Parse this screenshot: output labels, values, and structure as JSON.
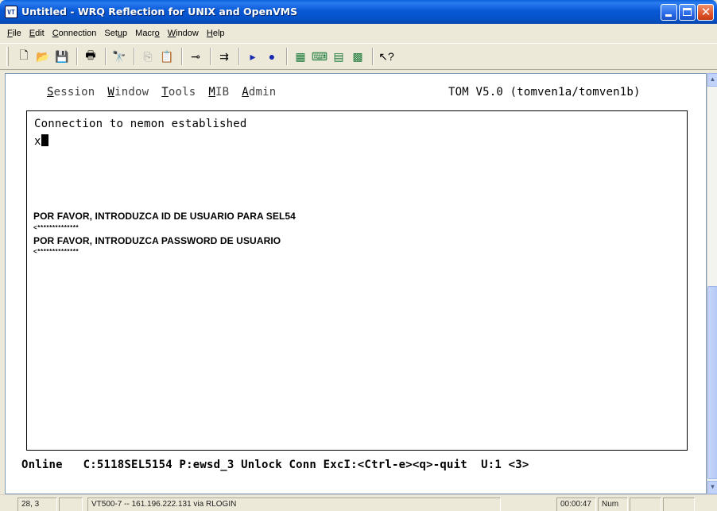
{
  "window": {
    "title": "Untitled - WRQ Reflection for UNIX and OpenVMS",
    "app_icon_label": "VT"
  },
  "menu": {
    "items": [
      {
        "label": "File",
        "accel": "F"
      },
      {
        "label": "Edit",
        "accel": "E"
      },
      {
        "label": "Connection",
        "accel": "C"
      },
      {
        "label": "Setup",
        "accel": "u"
      },
      {
        "label": "Macro",
        "accel": "o"
      },
      {
        "label": "Window",
        "accel": "W"
      },
      {
        "label": "Help",
        "accel": "H"
      }
    ]
  },
  "toolbar": {
    "buttons": [
      {
        "icon": "new-icon",
        "glyph": "🗋",
        "state": "enabled"
      },
      {
        "icon": "open-icon",
        "glyph": "📂",
        "state": "enabled"
      },
      {
        "icon": "save-icon",
        "glyph": "💾",
        "state": "enabled"
      },
      {
        "icon": "print-icon",
        "glyph": "🖶",
        "state": "enabled"
      },
      {
        "icon": "find-icon",
        "glyph": "🔭",
        "state": "enabled"
      },
      {
        "icon": "copy-icon",
        "glyph": "⎘",
        "state": "disabled"
      },
      {
        "icon": "paste-icon",
        "glyph": "📋",
        "state": "disabled"
      },
      {
        "icon": "connect-icon",
        "glyph": "⊸",
        "state": "enabled"
      },
      {
        "icon": "transfer-icon",
        "glyph": "⇉",
        "state": "enabled"
      },
      {
        "icon": "play-macro-icon",
        "glyph": "▸",
        "state": "enabled"
      },
      {
        "icon": "record-macro-icon",
        "glyph": "●",
        "state": "enabled"
      },
      {
        "icon": "setup-icon",
        "glyph": "▦",
        "state": "enabled"
      },
      {
        "icon": "keyboard-icon",
        "glyph": "⌨",
        "state": "enabled"
      },
      {
        "icon": "display-icon",
        "glyph": "▤",
        "state": "enabled"
      },
      {
        "icon": "colors-icon",
        "glyph": "▩",
        "state": "enabled"
      },
      {
        "icon": "context-help-icon",
        "glyph": "↖?",
        "state": "enabled"
      }
    ]
  },
  "terminal": {
    "menu": [
      {
        "label": "Session",
        "accel": "S",
        "rest": "ession"
      },
      {
        "label": "Window",
        "accel": "W",
        "rest": "indow"
      },
      {
        "label": "Tools",
        "accel": "T",
        "rest": "ools"
      },
      {
        "label": "MIB",
        "accel": "M",
        "rest": "IB"
      },
      {
        "label": "Admin",
        "accel": "A",
        "rest": "dmin"
      }
    ],
    "version": "TOM V5.0 (tomven1a/tomven1b)",
    "connection_line": "Connection to nemon established",
    "prompt_char": "x",
    "user_prompt": "POR FAVOR, INTRODUZCA ID DE USUARIO PARA SEL54",
    "user_mask": "<**************",
    "password_prompt": "POR FAVOR, INTRODUZCA PASSWORD DE USUARIO",
    "password_mask": "<**************",
    "status_line": "Online   C:5118SEL5154 P:ewsd_3 Unlock Conn ExcI:<Ctrl-e><q>-quit  U:1 <3>"
  },
  "statusbar": {
    "cursor_pos": "28, 3",
    "connection": "VT500-7 -- 161.196.222.131 via RLOGIN",
    "elapsed": "00:00:47",
    "num": "Num"
  },
  "colors": {
    "title_blue": "#0858d6",
    "close_red": "#e0552c",
    "chrome": "#ece9d8"
  }
}
